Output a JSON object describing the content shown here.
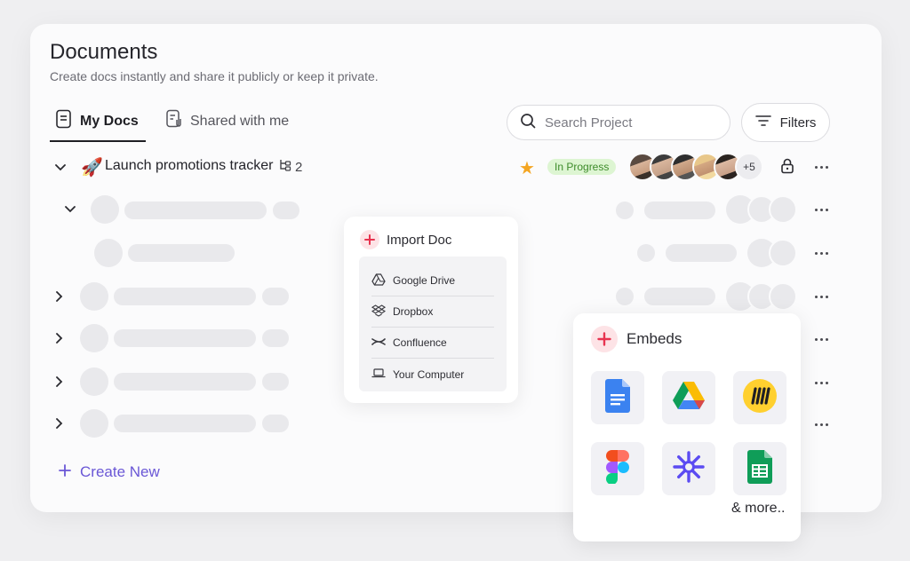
{
  "header": {
    "title": "Documents",
    "subtitle": "Create docs instantly and share it publicly or keep it private."
  },
  "tabs": [
    {
      "label": "My Docs",
      "active": true
    },
    {
      "label": "Shared with me",
      "active": false
    }
  ],
  "search": {
    "placeholder": "Search Project",
    "value": ""
  },
  "filters_label": "Filters",
  "project": {
    "emoji": "🚀",
    "title": "Launch promotions tracker",
    "subtask_count": "2",
    "starred": true,
    "status": "In Progress",
    "status_color": "#3d8b2a",
    "status_bg": "#ddf5d2",
    "extra_members": "+5"
  },
  "create_new_label": "Create New",
  "import_doc": {
    "title": "Import Doc",
    "items": [
      "Google Drive",
      "Dropbox",
      "Confluence",
      "Your Computer"
    ]
  },
  "embeds": {
    "title": "Embeds",
    "items": [
      "google-docs-icon",
      "google-drive-icon",
      "miro-icon",
      "figma-icon",
      "asterisk-app-icon",
      "google-sheets-icon"
    ],
    "more": "& more.."
  },
  "colors": {
    "accent": "#6a57d6",
    "plus_red": "#e8334f",
    "star": "#f4a521"
  }
}
